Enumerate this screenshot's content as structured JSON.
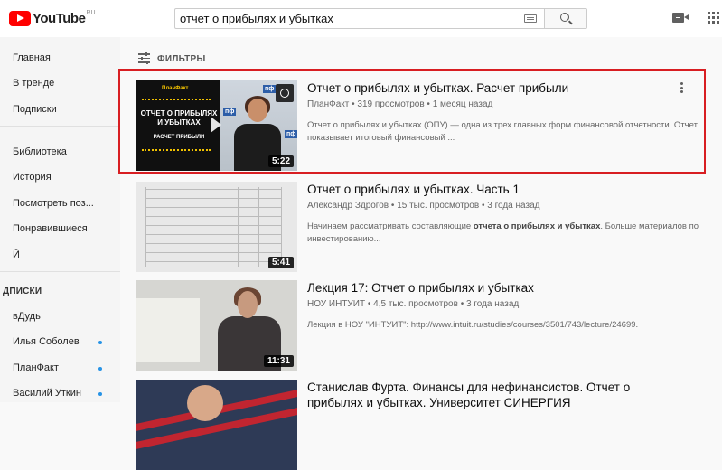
{
  "header": {
    "logo_text": "YouTube",
    "logo_region": "RU",
    "search_value": "отчет о прибылях и убытках",
    "icons": [
      "search-icon",
      "keyboard-icon",
      "upload-camera-icon",
      "apps-grid-icon"
    ]
  },
  "sidebar": {
    "items": [
      {
        "label": "Главная"
      },
      {
        "label": "В тренде"
      },
      {
        "label": "Подписки"
      },
      {
        "label": "Библиотека"
      },
      {
        "label": "История"
      },
      {
        "label": "Посмотреть поз..."
      },
      {
        "label": "Понравившиеся"
      },
      {
        "label": "Й"
      }
    ],
    "subscriptions_heading": "ДПИСКИ",
    "subscriptions": [
      {
        "label": "вДудь"
      },
      {
        "label": "Илья Соболев"
      },
      {
        "label": "ПланФакт"
      },
      {
        "label": "Василий Уткин"
      }
    ]
  },
  "filters": {
    "label": "ФИЛЬТРЫ"
  },
  "accent_color": "#d81e22",
  "videos": [
    {
      "title": "Отчет о прибылях и убытках. Расчет прибыли",
      "channel": "ПланФакт",
      "meta": "319 просмотров • 1 месяц назад",
      "description_1": "Отчет о прибылях и убытках (ОПУ) — одна из трех главных форм финансовой отчетности. Отчет",
      "description_2": "показывает итоговый финансовый ...",
      "duration": "5:22",
      "thumb": {
        "brand": "ПланФакт",
        "line1": "ОТЧЕТ О ПРИБЫЛЯХ",
        "line2": "И УБЫТКАХ",
        "line3": "РАСЧЕТ ПРИБЫЛИ",
        "badge": "пф"
      }
    },
    {
      "title": "Отчет о прибылях и убытках. Часть 1",
      "channel": "Александр Здрогов",
      "meta": "15 тыс. просмотров • 3 года назад",
      "description_pre": "Начинаем рассматривать составляющие ",
      "description_bold": "отчета о прибылях и убытках",
      "description_post": ". Больше материалов по",
      "description_2": "инвестированию...",
      "duration": "5:41"
    },
    {
      "title": "Лекция 17: Отчет о прибылях и убытках",
      "channel": "НОУ ИНТУИТ",
      "meta": "4,5 тыс. просмотров • 3 года назад",
      "description_1": "Лекция в НОУ \"ИНТУИТ\": http://www.intuit.ru/studies/courses/3501/743/lecture/24699.",
      "duration": "11:31"
    },
    {
      "title": "Станислав Фурта. Финансы для нефинансистов. Отчет о",
      "title_2": "прибылях и убытках. Университет СИНЕРГИЯ"
    }
  ]
}
